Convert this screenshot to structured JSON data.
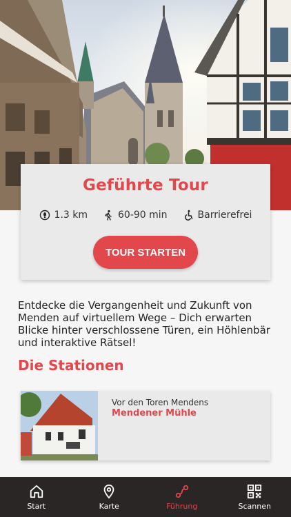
{
  "tour": {
    "title": "Geführte Tour",
    "distance": "1.3 km",
    "duration": "60-90 min",
    "accessibility": "Barrierefrei",
    "start_label": "TOUR STARTEN"
  },
  "intro_text": "Entdecke die Vergangenheit und Zukunft von Menden auf virtuellem Wege – Dich erwarten Blicke hinter verschlossene Türen, ein Höhlenbär und interaktive Rätsel!",
  "stations": {
    "title": "Die Stationen",
    "items": [
      {
        "subtitle": "Vor den Toren Mendens",
        "name": "Mendener Mühle"
      }
    ]
  },
  "nav": {
    "items": [
      {
        "label": "Start",
        "icon": "home-icon"
      },
      {
        "label": "Karte",
        "icon": "map-pin-icon"
      },
      {
        "label": "Führung",
        "icon": "route-icon",
        "active": true
      },
      {
        "label": "Scannen",
        "icon": "qr-code-icon"
      }
    ]
  },
  "colors": {
    "accent": "#e2474b",
    "nav_bg": "#2a2625",
    "card_bg": "#eaeaeb"
  }
}
